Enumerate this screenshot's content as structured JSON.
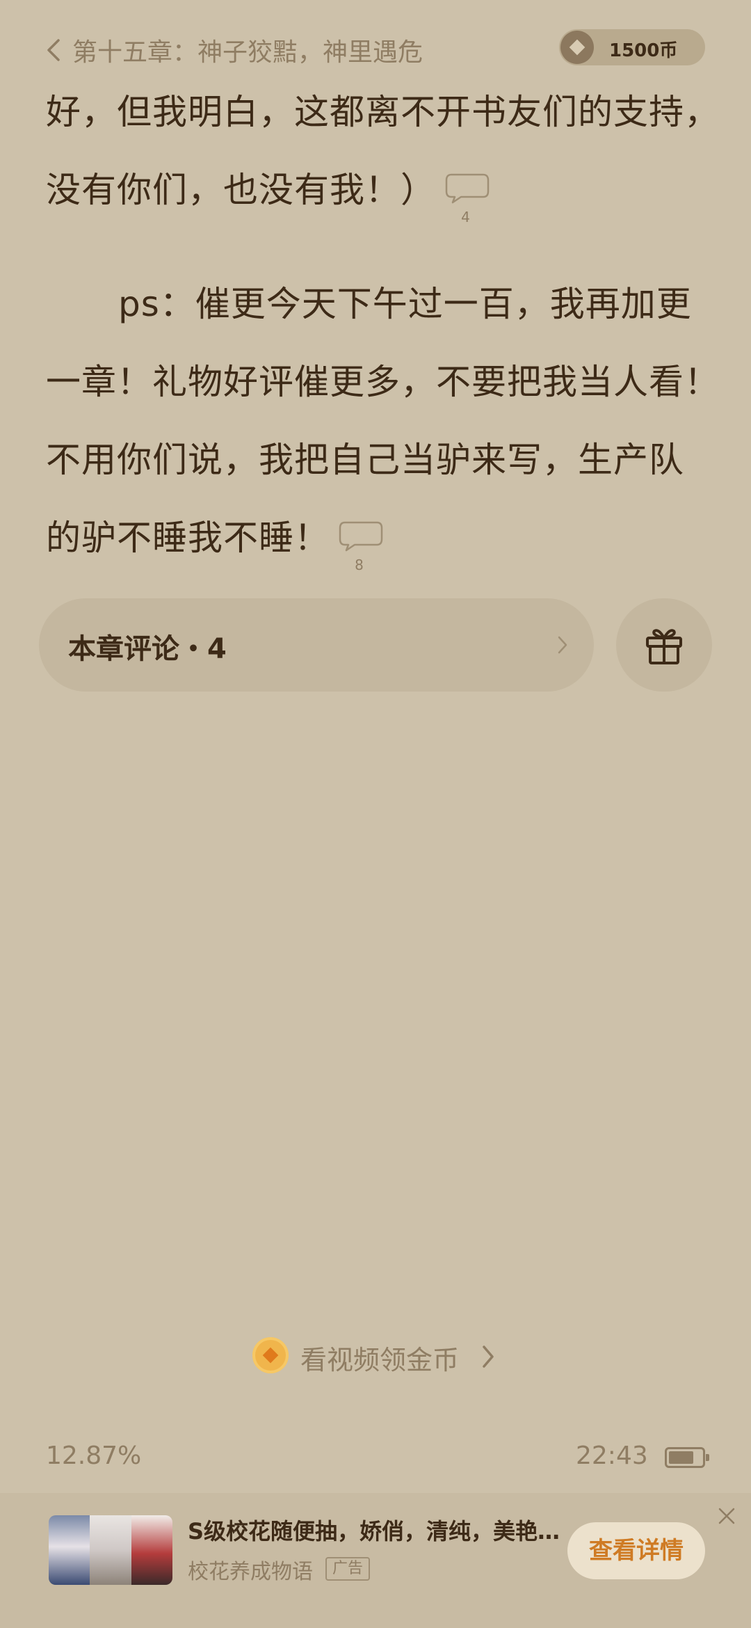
{
  "header": {
    "back_icon": "chevron-left-icon",
    "chapter_title": "第十五章：神子狡黠，神里遇危",
    "coin_balance": "1500币"
  },
  "content": {
    "paragraphs": [
      {
        "lines": [
          "好，但我明白，这都离不开书友们的支持，",
          "没有你们，也没有我！）"
        ],
        "comment_count": "4"
      },
      {
        "lines": [
          "ps：催更今天下午过一百，我再加更",
          "一章！礼物好评催更多，不要把我当人看！",
          "不用你们说，我把自己当驴来写，生产队",
          "的驴不睡我不睡！"
        ],
        "comment_count": "8"
      }
    ]
  },
  "comments": {
    "label": "本章评论・4",
    "chevron_icon": "chevron-right-icon",
    "gift_icon": "gift-icon"
  },
  "video_reward": {
    "label": "看视频领金币",
    "icon": "gold-coin-icon"
  },
  "status": {
    "progress": "12.87%",
    "time": "22:43",
    "battery_level": 0.75
  },
  "ad": {
    "title": "S级校花随便抽，娇俏，清纯，美艳…",
    "subtitle": "校花养成物语",
    "tag": "广告",
    "cta": "查看详情",
    "close_icon": "close-icon"
  },
  "colors": {
    "background": "#cdc1aa",
    "text": "#3d2a17",
    "muted": "#8f7d63",
    "accent": "#cf7b24"
  }
}
